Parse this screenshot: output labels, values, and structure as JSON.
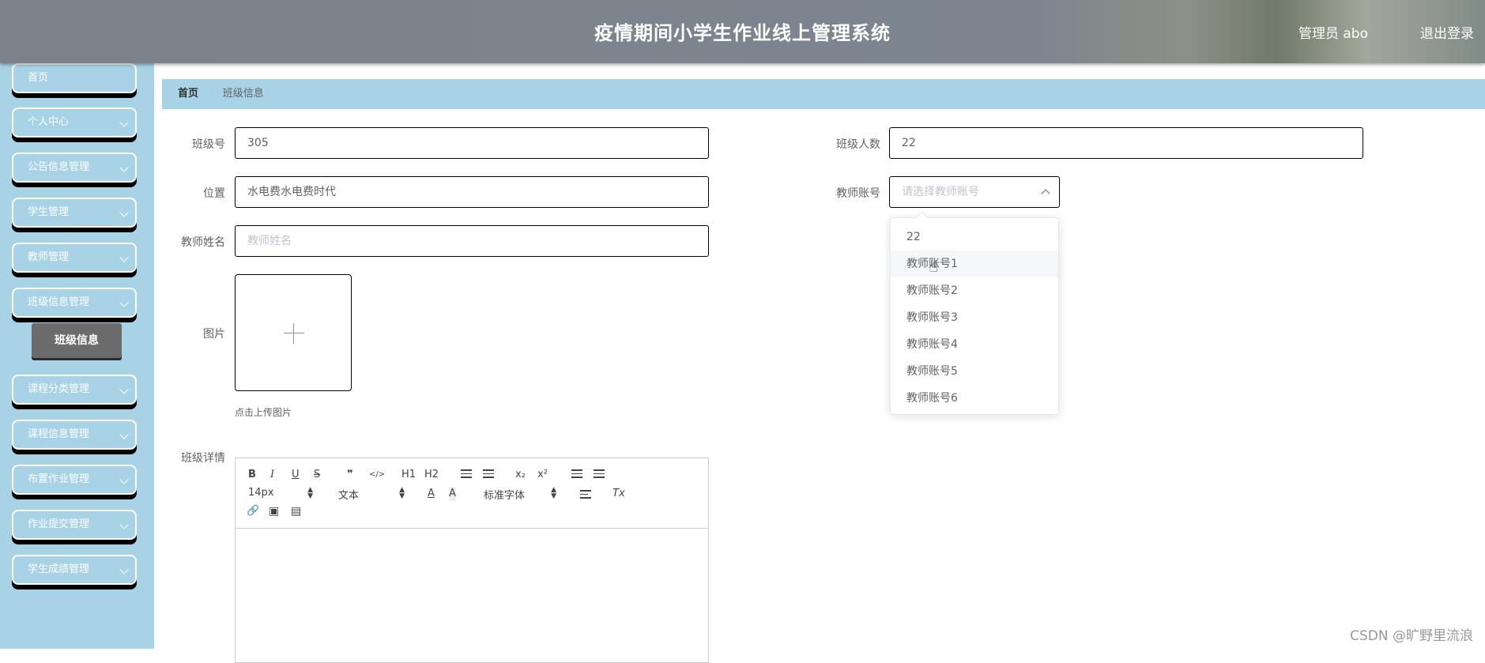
{
  "header": {
    "title": "疫情期间小学生作业线上管理系统",
    "user": "管理员 abo",
    "logout": "退出登录"
  },
  "sidebar": {
    "items": [
      {
        "label": "首页"
      },
      {
        "label": "个人中心"
      },
      {
        "label": "公告信息管理"
      },
      {
        "label": "学生管理"
      },
      {
        "label": "教师管理"
      },
      {
        "label": "班级信息管理"
      },
      {
        "label": "课程分类管理"
      },
      {
        "label": "课程信息管理"
      },
      {
        "label": "布置作业管理"
      },
      {
        "label": "作业提交管理"
      },
      {
        "label": "学生成绩管理"
      }
    ],
    "active_sub": "班级信息"
  },
  "breadcrumb": {
    "home": "首页",
    "current": "班级信息"
  },
  "form": {
    "class_no": {
      "label": "班级号",
      "value": "305"
    },
    "class_size": {
      "label": "班级人数",
      "value": "22"
    },
    "location": {
      "label": "位置",
      "value": "水电费水电费时代"
    },
    "teacher_account": {
      "label": "教师账号",
      "placeholder": "请选择教师账号"
    },
    "teacher_name": {
      "label": "教师姓名",
      "placeholder": "教师姓名"
    },
    "image": {
      "label": "图片",
      "tip": "点击上传图片"
    },
    "detail": {
      "label": "班级详情"
    }
  },
  "dropdown": {
    "options": [
      "22",
      "教师账号1",
      "教师账号2",
      "教师账号3",
      "教师账号4",
      "教师账号5",
      "教师账号6"
    ],
    "hovered_index": 1
  },
  "editor": {
    "bold": "B",
    "italic": "I",
    "underline": "U",
    "strike": "S",
    "quote": "❞",
    "code": "</>",
    "h1": "H1",
    "h2": "H2",
    "sub": "x₂",
    "sup": "x²",
    "size": "14px",
    "header": "文本",
    "font": "标准字体",
    "color": "A",
    "background": "A",
    "clean": "Tx",
    "link": "🔗",
    "image": "▣",
    "video": "▤"
  },
  "watermark": "CSDN @旷野里流浪"
}
